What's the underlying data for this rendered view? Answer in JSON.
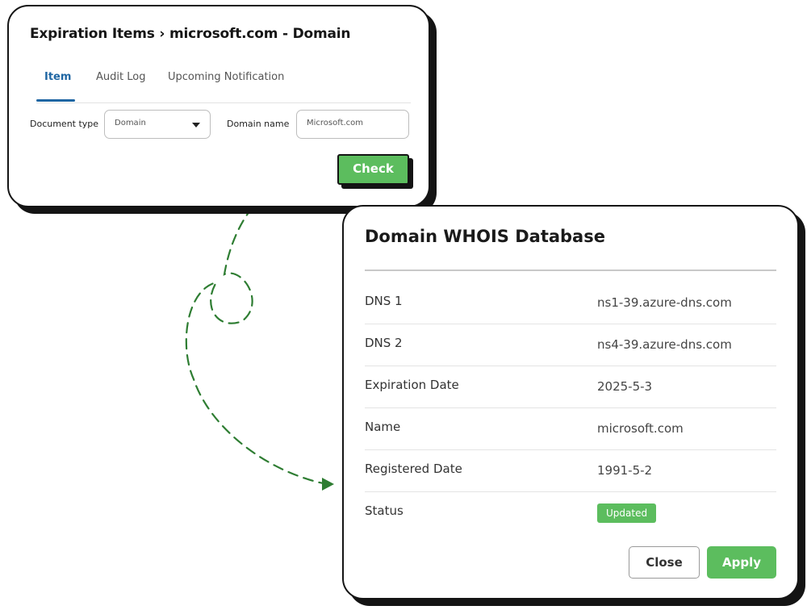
{
  "expiration_card": {
    "title": "Expiration Items › microsoft.com - Domain",
    "tabs": [
      {
        "label": "Item",
        "active": true
      },
      {
        "label": "Audit Log",
        "active": false
      },
      {
        "label": "Upcoming Notification",
        "active": false
      }
    ],
    "document_type": {
      "label": "Document type",
      "selected": "Domain"
    },
    "domain_name": {
      "label": "Domain name",
      "value": "Microsoft.com"
    },
    "check_label": "Check"
  },
  "whois_card": {
    "title": "Domain WHOIS Database",
    "rows": [
      {
        "key": "DNS 1",
        "value": "ns1-39.azure-dns.com"
      },
      {
        "key": "DNS 2",
        "value": "ns4-39.azure-dns.com"
      },
      {
        "key": "Expiration Date",
        "value": "2025-5-3"
      },
      {
        "key": "Name",
        "value": "microsoft.com"
      },
      {
        "key": "Registered Date",
        "value": "1991-5-2"
      },
      {
        "key": "Status",
        "value": "Updated"
      }
    ],
    "close_label": "Close",
    "apply_label": "Apply"
  },
  "colors": {
    "accent_green": "#5cbd5e",
    "connector_green": "#2e7d32",
    "tab_active_blue": "#1f66a3",
    "outline": "#141414"
  }
}
